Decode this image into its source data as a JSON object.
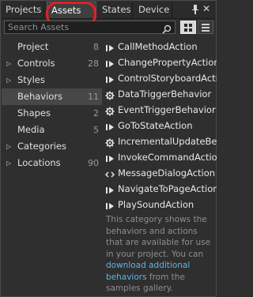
{
  "tabs": [
    {
      "label": "Projects"
    },
    {
      "label": "Assets"
    },
    {
      "label": "States"
    },
    {
      "label": "Device"
    }
  ],
  "search": {
    "placeholder": "Search Assets"
  },
  "categories": [
    {
      "label": "Project",
      "count": "8"
    },
    {
      "label": "Controls",
      "count": "28"
    },
    {
      "label": "Styles",
      "count": ""
    },
    {
      "label": "Behaviors",
      "count": "11"
    },
    {
      "label": "Shapes",
      "count": "2"
    },
    {
      "label": "Media",
      "count": "5"
    },
    {
      "label": "Categories",
      "count": ""
    },
    {
      "label": "Locations",
      "count": "90"
    }
  ],
  "items": [
    {
      "label": "CallMethodAction",
      "icon": "action-icon"
    },
    {
      "label": "ChangePropertyAction",
      "icon": "action-icon"
    },
    {
      "label": "ControlStoryboardAction",
      "icon": "action-icon"
    },
    {
      "label": "DataTriggerBehavior",
      "icon": "gear-icon"
    },
    {
      "label": "EventTriggerBehavior",
      "icon": "gear-icon"
    },
    {
      "label": "GoToStateAction",
      "icon": "action-icon"
    },
    {
      "label": "IncrementalUpdateBehavior",
      "icon": "gear-icon"
    },
    {
      "label": "InvokeCommandAction",
      "icon": "action-icon"
    },
    {
      "label": "MessageDialogAction",
      "icon": "code-icon"
    },
    {
      "label": "NavigateToPageAction",
      "icon": "action-icon"
    },
    {
      "label": "PlaySoundAction",
      "icon": "action-icon"
    }
  ],
  "description": {
    "text": "This category shows the behaviors and actions that are available for use in your project. You can ",
    "link": "download additional behaviors",
    "suffix": " from the samples gallery."
  },
  "colors": {
    "highlight": "#e21f26",
    "link": "#5db4e6",
    "selected_bg": "#474747"
  }
}
